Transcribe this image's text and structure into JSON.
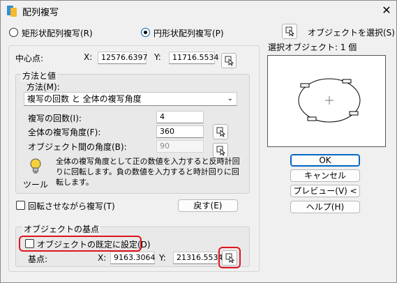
{
  "window": {
    "title": "配列複写",
    "close_symbol": "✕"
  },
  "mode": {
    "rect_label": "矩形状配列複写(R)",
    "polar_label": "円形状配列複写(P)",
    "selected": "polar"
  },
  "select_objects": {
    "label": "オブジェクトを選択(S)",
    "count_text": "選択オブジェクト: 1 個"
  },
  "center_point": {
    "label": "中心点:",
    "x_label": "X:",
    "x_value": "12576.6397",
    "y_label": "Y:",
    "y_value": "11716.5534"
  },
  "method_group": {
    "title": "方法と値",
    "method_label": "方法(M):",
    "method_value": "複写の回数 と 全体の複写角度",
    "count_label": "複写の回数(I):",
    "count_value": "4",
    "total_angle_label": "全体の複写角度(F):",
    "total_angle_value": "360",
    "between_angle_label": "オブジェクト間の角度(B):",
    "between_angle_value": "90",
    "tip_text": "全体の複写角度として正の数値を入力すると反時計回りに回転します。負の数値を入力すると時計回りに回転します。",
    "tip_label": "ツール"
  },
  "rotate": {
    "label": "回転させながら複写(T)",
    "checked": false
  },
  "reset_button": "戻す(E)",
  "base_point": {
    "title": "オブジェクトの基点",
    "default_label": "オブジェクトの既定に設定(D)",
    "default_checked": false,
    "label": "基点:",
    "x_label": "X:",
    "x_value": "9163.3064",
    "y_label": "Y:",
    "y_value": "21316.5534"
  },
  "buttons": {
    "ok": "OK",
    "cancel": "キャンセル",
    "preview": "プレビュー(V) <",
    "help": "ヘルプ(H)"
  },
  "highlight_color": "#e0141e",
  "accent_color": "#0067c0"
}
